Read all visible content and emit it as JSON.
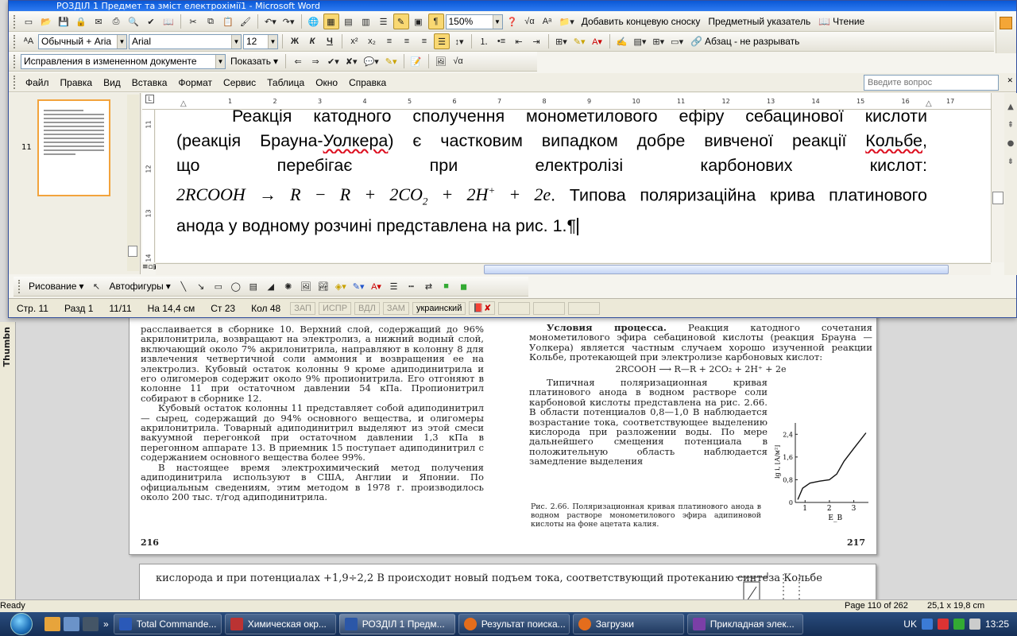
{
  "word": {
    "title": "РОЗДІЛ 1 Предмет та зміст електрохімії1 - Microsoft Word",
    "toolbar_standard": {
      "zoom": "150%",
      "add_endnote": "Добавить концевую сноску",
      "index": "Предметный указатель",
      "reading": "Чтение"
    },
    "toolbar_format": {
      "style": "Обычный + Aria",
      "font": "Arial",
      "size": "12",
      "bold": "Ж",
      "italic": "К",
      "underline": "Ч",
      "paragraph_label": "Абзац - не разрывать"
    },
    "toolbar_review": {
      "mode": "Исправления в измененном документе",
      "show": "Показать"
    },
    "menu": [
      "Файл",
      "Правка",
      "Вид",
      "Вставка",
      "Формат",
      "Сервис",
      "Таблица",
      "Окно",
      "Справка"
    ],
    "help_placeholder": "Введите вопрос",
    "thumbnail_page": "11",
    "ruler_h": [
      "1",
      "2",
      "3",
      "4",
      "5",
      "6",
      "7",
      "8",
      "9",
      "10",
      "11",
      "12",
      "13",
      "14",
      "15",
      "16",
      "17"
    ],
    "ruler_v": [
      "11",
      "12",
      "13",
      "14"
    ],
    "document": {
      "line0": "Реакція катодного сполучення монометилового ефіру себацинової кислоти",
      "line1a": "(реакція Брауна-",
      "line1_sq1": "Уолкера",
      "line1b": ") є частковим випадком добре вивченої реакції ",
      "line1_sq2": "Кольбе",
      "line1c": ",",
      "line2": "що перебігає при електролізі карбонових кислот:",
      "formula": "2RCOOH → R − R + 2CO",
      "formula_sub": "2",
      "formula_tail": " + 2H",
      "formula_sup": "+",
      "formula_end": " + 2e",
      "line3_rest": ". Типова поляризаційна крива платинового",
      "line4": "анода у водному розчині представлена на рис. 1.¶"
    },
    "drawing_toolbar": {
      "drawing": "Рисование",
      "autoshapes": "Автофигуры"
    },
    "status": {
      "page": "Стр. 11",
      "section": "Разд 1",
      "pages": "11/11",
      "at": "На 14,4 см",
      "line": "Ст 23",
      "col": "Кол 48",
      "rec": "ЗАП",
      "trk": "ИСПР",
      "ext": "ВДЛ",
      "ovr": "ЗАМ",
      "lang": "украинский"
    }
  },
  "viewer": {
    "thumbnails_label": "Thumbn",
    "ready": "Ready",
    "page_of": "Page 110 of 262",
    "size": "25,1 x 19,8 cm",
    "page_left_num": "216",
    "page_right_num": "217",
    "left_column": [
      "расслаивается в сборнике 10. Верхний слой, содержащий до 96% акрилонитрила, возвращают на электролиз, а нижний водный слой, включающий около 7% акрилонитрила, направляют в колонну 8 для извлечения четвертичной соли аммония и возвращения ее на электролиз. Кубовый остаток колонны 9 кроме адиподинитрила и его олигомеров содержит около 9% пропионитрила. Его отгоняют в колонне 11 при остаточном давлении 54 кПа. Пропионитрил собирают в сборнике 12.",
      "Кубовый остаток колонны 11 представляет собой адиподинитрил — сырец, содержащий до 94% основного вещества, и олигомеры акрилонитрила. Товарный адиподинитрил выделяют из этой смеси вакуумной перегонкой при остаточном давлении 1,3 кПа в перегонном аппарате 13. В приемник 15 поступает адиподинитрил с содержанием основного вещества более 99%.",
      "В настоящее время электрохимический метод получения адиподинитрила используют в США, Англии и Японии. По официальным сведениям, этим методом в 1978 г. производилось около 200 тыс. т/год адиподинитрила."
    ],
    "right_heading": "Условия процесса.",
    "right_para1": " Реакция катодного сочетания монометилового эфира себациновой кислоты (реакция Брауна — Уолкера) является частным случаем хорошо изученной реакции Кольбе, протекающей при электролизе карбоновых кислот:",
    "right_formula": "2RCOOH ⟶ R—R + 2CO₂ + 2H⁺ + 2e",
    "right_para2": "Типичная поляризационная кривая платинового анода в водном растворе соли карбоновой кислоты представлена на рис. 2.66. В области потенциалов 0,8—1,0 В наблюдается возрастание тока, соответствующее выделению кислорода при разложении воды. По мере дальнейшего смещения потенциала в положительную область наблюдается замедление выделения",
    "fig_caption": "Рис. 2.66. Поляризационная кривая платинового анода в водном растворе монометилового эфира адипиновой кислоты на фоне ацетата калия.",
    "page2_text": "кислорода и при потенциалах +1,9÷2,2 В происходит новый подъем тока, соответствующий протеканию синтеза Кольбе"
  },
  "chart_data": {
    "type": "line",
    "title": "",
    "xlabel": "E_B",
    "ylabel": "lg i, [А/м²]",
    "x_ticks": [
      "1",
      "2",
      "3"
    ],
    "y_ticks": [
      "0",
      "0,8",
      "1,6",
      "2,4"
    ],
    "xlim": [
      0.6,
      3.6
    ],
    "ylim": [
      0,
      2.8
    ],
    "series": [
      {
        "x": [
          0.7,
          0.9,
          1.2,
          1.6,
          2.0,
          2.3,
          2.6,
          3.0,
          3.5
        ],
        "y": [
          0.1,
          0.5,
          0.68,
          0.75,
          0.8,
          1.0,
          1.45,
          1.9,
          2.45
        ]
      }
    ]
  },
  "taskbar": {
    "tasks": [
      "Total Commande...",
      "Химическая окр...",
      "РОЗДІЛ 1 Предм...",
      "Результат поиска...",
      "Загрузки",
      "Прикладная элек..."
    ],
    "lang": "UK",
    "time": "13:25"
  }
}
